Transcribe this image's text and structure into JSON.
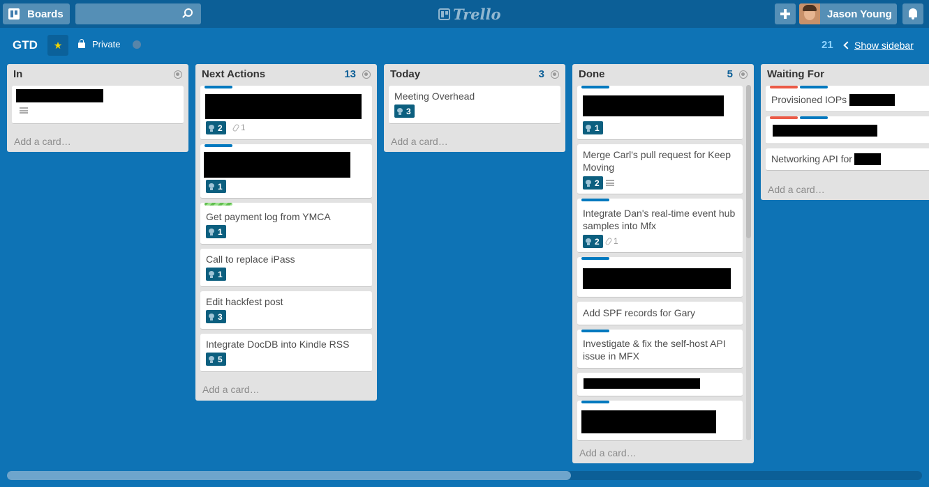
{
  "header": {
    "boards_label": "Boards",
    "search_value": "",
    "logo_text": "Trello",
    "user_name": "Jason Young"
  },
  "board": {
    "title": "GTD",
    "visibility": "Private",
    "count": "21",
    "sidebar_link": "Show sidebar"
  },
  "colors": {
    "background": "#0e73b5",
    "header": "#0c5f97",
    "list_bg": "#e2e2e2",
    "badge": "#0c5f7f",
    "label_blue": "#0079bf",
    "label_red": "#eb5a46",
    "label_green": "#61bd4f"
  },
  "lists": [
    {
      "title": "In",
      "count": "",
      "add_card": "Add a card…",
      "cards": [
        {
          "title": "",
          "redacted": true,
          "has_description": true
        }
      ]
    },
    {
      "title": "Next Actions",
      "count": "13",
      "add_card": "Add a card…",
      "cards": [
        {
          "title": "",
          "redacted": true,
          "labels": [
            "blue"
          ],
          "checklist": "2",
          "attachments": "1"
        },
        {
          "title": "",
          "redacted": true,
          "labels": [
            "blue"
          ],
          "checklist": "1"
        },
        {
          "title": "Get payment log from YMCA",
          "labels": [
            "green"
          ],
          "checklist": "1"
        },
        {
          "title": "Call to replace iPass",
          "checklist": "1"
        },
        {
          "title": "Edit hackfest post",
          "checklist": "3"
        },
        {
          "title": "Integrate DocDB into Kindle RSS",
          "checklist": "5"
        }
      ]
    },
    {
      "title": "Today",
      "count": "3",
      "add_card": "Add a card…",
      "cards": [
        {
          "title": "Meeting Overhead",
          "checklist": "3"
        }
      ]
    },
    {
      "title": "Done",
      "count": "5",
      "add_card": "Add a card…",
      "cards": [
        {
          "title": "",
          "redacted": true,
          "labels": [
            "blue"
          ],
          "checklist": "1"
        },
        {
          "title": "Merge Carl's pull request for Keep Moving",
          "checklist": "2",
          "has_description": true
        },
        {
          "title": "Integrate Dan's real-time event hub samples into Mfx",
          "labels": [
            "blue"
          ],
          "checklist": "2",
          "attachments": "1"
        },
        {
          "title": "",
          "redacted": true,
          "labels": [
            "blue"
          ]
        },
        {
          "title": "Add SPF records for Gary"
        },
        {
          "title": "Investigate & fix the self-host API issue in MFX",
          "labels": [
            "blue"
          ]
        },
        {
          "title": "",
          "redacted": true
        },
        {
          "title": "",
          "redacted": true,
          "labels": [
            "blue"
          ]
        }
      ]
    },
    {
      "title": "Waiting For",
      "count": "",
      "add_card": "Add a card…",
      "cards": [
        {
          "title": "Provisioned IOPs",
          "labels": [
            "red",
            "blue"
          ],
          "partially_redacted": true
        },
        {
          "title": "",
          "redacted": true,
          "labels": [
            "red",
            "blue"
          ]
        },
        {
          "title": "Networking API for",
          "partially_redacted": true
        }
      ]
    }
  ]
}
